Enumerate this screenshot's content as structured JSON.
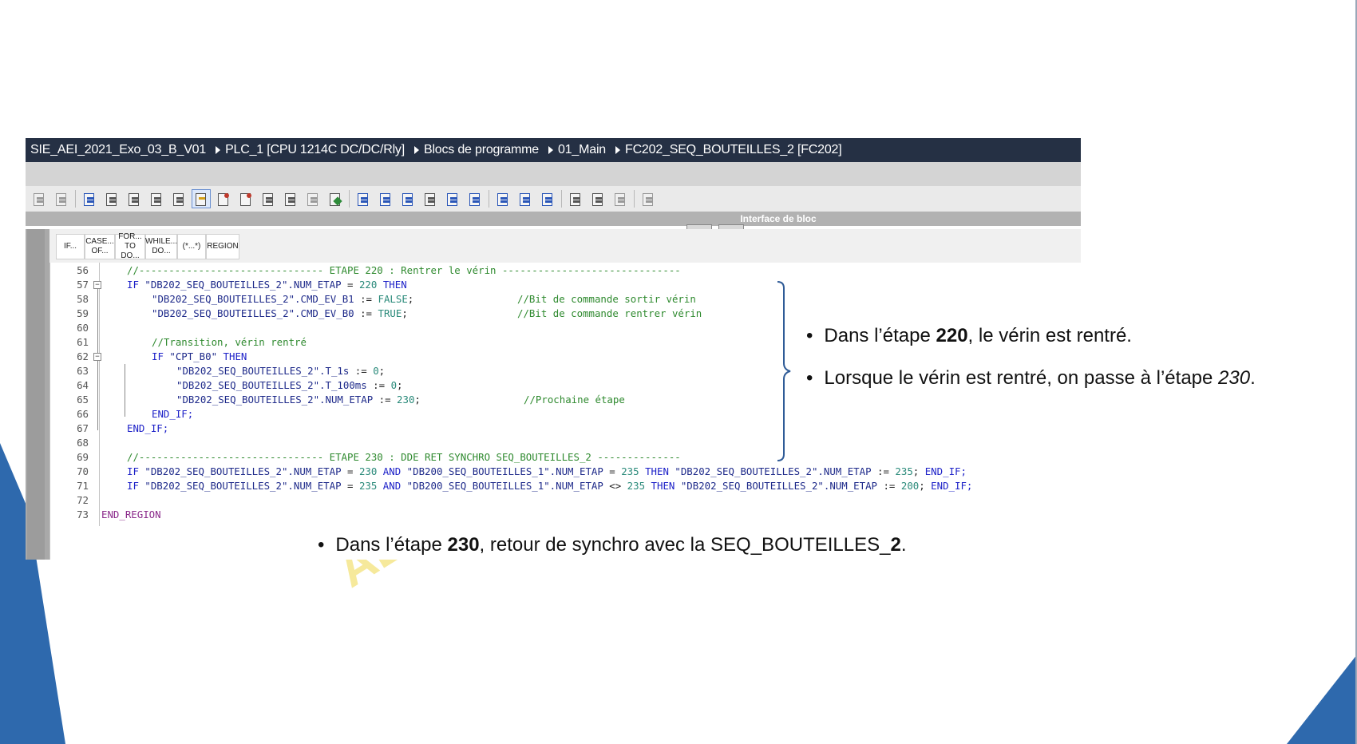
{
  "breadcrumb": {
    "project": "SIE_AEI_2021_Exo_03_B_V01",
    "device": "PLC_1 [CPU 1214C DC/DC/Rly]",
    "folder": "Blocs de programme",
    "group": "01_Main",
    "block": "FC202_SEQ_BOUTEILLES_2 [FC202]"
  },
  "interface_bar": {
    "label": "Interface de bloc"
  },
  "snippets": [
    {
      "line1": "IF...",
      "line2": ""
    },
    {
      "line1": "CASE...",
      "line2": "OF..."
    },
    {
      "line1": "FOR...",
      "line2": "TO DO..."
    },
    {
      "line1": "WHILE...",
      "line2": "DO..."
    },
    {
      "line1": "(*...*)",
      "line2": ""
    },
    {
      "line1": "REGION",
      "line2": ""
    }
  ],
  "code": {
    "l56": {
      "num": "56",
      "text": "//------------------------------- ETAPE 220 : Rentrer le vérin ------------------------------"
    },
    "l57": {
      "num": "57",
      "if": "IF",
      "a": "\"DB202_SEQ_BOUTEILLES_2\".NUM_ETAP",
      "op": " = ",
      "val": "220",
      "then": " THEN"
    },
    "l58": {
      "num": "58",
      "a": "\"DB202_SEQ_BOUTEILLES_2\".CMD_EV_B1",
      "op": " := ",
      "val": "FALSE",
      "end": ";",
      "comment": "//Bit de commande sortir vérin"
    },
    "l59": {
      "num": "59",
      "a": "\"DB202_SEQ_BOUTEILLES_2\".CMD_EV_B0",
      "op": " := ",
      "val": "TRUE",
      "end": ";",
      "comment": "//Bit de commande rentrer vérin"
    },
    "l60": {
      "num": "60"
    },
    "l61": {
      "num": "61",
      "comment": "//Transition, vérin rentré"
    },
    "l62": {
      "num": "62",
      "if": "IF",
      "a": " \"CPT_B0\"",
      "then": " THEN"
    },
    "l63": {
      "num": "63",
      "a": "\"DB202_SEQ_BOUTEILLES_2\".T_1s",
      "op": " := ",
      "val": "0",
      "end": ";"
    },
    "l64": {
      "num": "64",
      "a": "\"DB202_SEQ_BOUTEILLES_2\".T_100ms",
      "op": " := ",
      "val": "0",
      "end": ";"
    },
    "l65": {
      "num": "65",
      "a": "\"DB202_SEQ_BOUTEILLES_2\".NUM_ETAP",
      "op": " := ",
      "val": "230",
      "end": ";",
      "comment": "//Prochaine étape"
    },
    "l66": {
      "num": "66",
      "endif": "END_IF;"
    },
    "l67": {
      "num": "67",
      "endif": "END_IF;"
    },
    "l68": {
      "num": "68"
    },
    "l69": {
      "num": "69",
      "text": "//------------------------------- ETAPE 230 : DDE RET SYNCHRO SEQ_BOUTEILLES_2 --------------"
    },
    "l70": {
      "num": "70",
      "if": "IF",
      "a": " \"DB202_SEQ_BOUTEILLES_2\".NUM_ETAP",
      "op1": " = ",
      "v1": "230",
      "and": " AND",
      "b": " \"DB200_SEQ_BOUTEILLES_1\".NUM_ETAP",
      "op2": " = ",
      "v2": "235",
      "then": " THEN",
      "c": " \"DB202_SEQ_BOUTEILLES_2\".NUM_ETAP",
      "op3": " := ",
      "v3": "235",
      "semi": ";",
      "endif": " END_IF;"
    },
    "l71": {
      "num": "71",
      "if": "IF",
      "a": " \"DB202_SEQ_BOUTEILLES_2\".NUM_ETAP",
      "op1": " = ",
      "v1": "235",
      "and": " AND",
      "b": " \"DB200_SEQ_BOUTEILLES_1\".NUM_ETAP",
      "op2": " <> ",
      "v2": "235",
      "then": " THEN",
      "c": " \"DB202_SEQ_BOUTEILLES_2\".NUM_ETAP",
      "op3": " := ",
      "v3": "200",
      "semi": ";",
      "endif": " END_IF;"
    },
    "l72": {
      "num": "72"
    },
    "l73": {
      "num": "73",
      "end_region": "END_REGION"
    }
  },
  "bullets": {
    "b1": {
      "pre": "Dans l’étape ",
      "bold": "220",
      "post": ", le vérin est rentré."
    },
    "b2": {
      "pre": "Lorsque le vérin est rentré, on passe à l’étape ",
      "ital": "230",
      "post": "."
    },
    "b3": {
      "pre": "Dans l’étape ",
      "bold1": "230",
      "mid": ", retour de synchro avec la SEQ_BOUTEILLES_",
      "bold2": "2",
      "post": "."
    }
  },
  "watermark": {
    "text": "AEI"
  },
  "colors": {
    "brace": "#2f5b97",
    "deco_blue": "#2e69ad",
    "breadcrumb_bg": "#253044"
  }
}
